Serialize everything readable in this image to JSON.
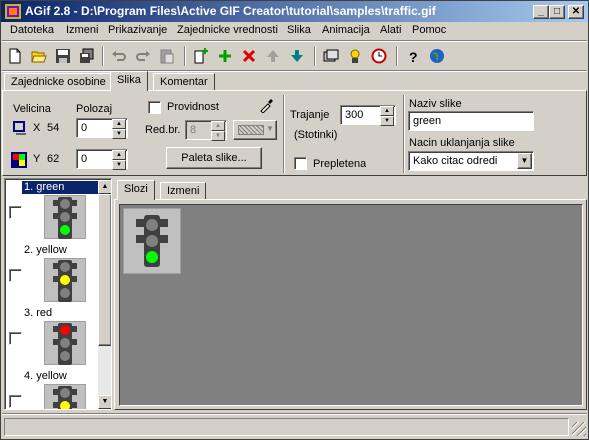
{
  "window": {
    "title": "AGif 2.8 - D:\\Program Files\\Active GIF Creator\\tutorial\\samples\\traffic.gif",
    "minimize_glyph": "_",
    "maximize_glyph": "□",
    "close_glyph": "✕"
  },
  "menu": [
    {
      "label": "Datoteka"
    },
    {
      "label": "Izmeni"
    },
    {
      "label": "Prikazivanje"
    },
    {
      "label": "Zajednicke vrednosti"
    },
    {
      "label": "Slika"
    },
    {
      "label": "Animacija"
    },
    {
      "label": "Alati"
    },
    {
      "label": "Pomoc"
    }
  ],
  "toolbar_icons": [
    "new-file-icon",
    "open-folder-icon",
    "save-icon",
    "save-as-icon",
    "undo-icon",
    "redo-icon",
    "paste-icon",
    "add-frame-icon",
    "insert-frame-icon",
    "delete-icon",
    "move-up-icon",
    "move-down-icon",
    "preview-icon",
    "wizard-icon",
    "clock-icon",
    "help-icon",
    "web-icon"
  ],
  "top_tabs": [
    {
      "label": "Zajednicke osobine"
    },
    {
      "label": "Slika"
    },
    {
      "label": "Komentar"
    }
  ],
  "properties": {
    "velicina_label": "Velicina",
    "polozaj_label": "Polozaj",
    "x_label": "X",
    "x_size": "54",
    "y_label": "Y",
    "y_size": "62",
    "pos_x": "0",
    "pos_y": "0",
    "providnost_label": "Providnost",
    "redbr_label": "Red.br.",
    "redbr_value": "8",
    "paleta_button": "Paleta slike...",
    "trajanje_label": "Trajanje",
    "trajanje_value": "300",
    "stotinki_label": "(Stotinki)",
    "prepletena_label": "Prepletena",
    "naziv_label": "Naziv slike",
    "naziv_value": "green",
    "nacin_label": "Nacin uklanjanja slike",
    "nacin_value": "Kako citac odredi"
  },
  "frames": [
    {
      "label": "1. green",
      "selected": true,
      "lit": "green"
    },
    {
      "label": "2. yellow",
      "selected": false,
      "lit": "yellow"
    },
    {
      "label": "3. red",
      "selected": false,
      "lit": "red"
    },
    {
      "label": "4. yellow",
      "selected": false,
      "lit": "yellow"
    }
  ],
  "view_tabs": [
    {
      "label": "Slozi"
    },
    {
      "label": "Izmeni"
    }
  ],
  "colors": {
    "green": "#00ff00",
    "yellow": "#ffff00",
    "red": "#ff0000",
    "off": "#808080",
    "canvas": "#808080",
    "selection": "#0a246a"
  }
}
